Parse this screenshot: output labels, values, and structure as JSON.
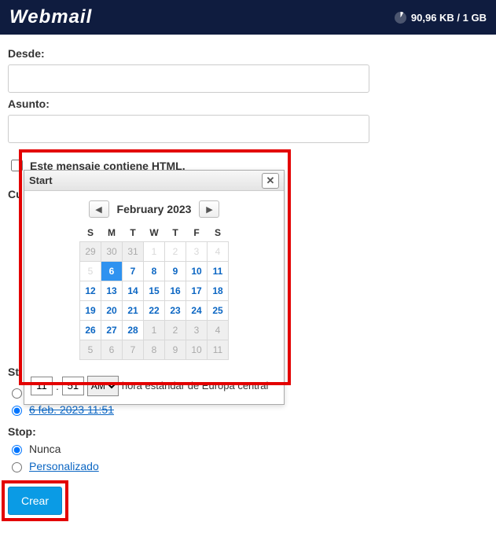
{
  "header": {
    "logo": "Webmail",
    "storage": "90,96 KB / 1 GB"
  },
  "form": {
    "desde_label": "Desde:",
    "asunto_label": "Asunto:",
    "html_checkbox_label": "Este mensaje contiene HTML.",
    "cuerpo_partial": "Cu",
    "start_partial": "St",
    "start_date_link": "6 feb. 2023 11:51",
    "stop_label": "Stop:",
    "stop_never": "Nunca",
    "stop_custom": "Personalizado",
    "create_btn": "Crear"
  },
  "datepicker": {
    "title": "Start",
    "month": "February 2023",
    "dow": [
      "S",
      "M",
      "T",
      "W",
      "T",
      "F",
      "S"
    ],
    "weeks": [
      [
        {
          "d": "29",
          "cls": "other"
        },
        {
          "d": "30",
          "cls": "other"
        },
        {
          "d": "31",
          "cls": "other"
        },
        {
          "d": "1",
          "cls": "past-sat"
        },
        {
          "d": "2",
          "cls": "past-sat"
        },
        {
          "d": "3",
          "cls": "past-sat"
        },
        {
          "d": "4",
          "cls": "past-sat"
        }
      ],
      [
        {
          "d": "5",
          "cls": "past-sat"
        },
        {
          "d": "6",
          "cls": "sel"
        },
        {
          "d": "7",
          "cls": ""
        },
        {
          "d": "8",
          "cls": ""
        },
        {
          "d": "9",
          "cls": ""
        },
        {
          "d": "10",
          "cls": ""
        },
        {
          "d": "11",
          "cls": ""
        }
      ],
      [
        {
          "d": "12",
          "cls": ""
        },
        {
          "d": "13",
          "cls": ""
        },
        {
          "d": "14",
          "cls": ""
        },
        {
          "d": "15",
          "cls": ""
        },
        {
          "d": "16",
          "cls": ""
        },
        {
          "d": "17",
          "cls": ""
        },
        {
          "d": "18",
          "cls": ""
        }
      ],
      [
        {
          "d": "19",
          "cls": ""
        },
        {
          "d": "20",
          "cls": ""
        },
        {
          "d": "21",
          "cls": ""
        },
        {
          "d": "22",
          "cls": ""
        },
        {
          "d": "23",
          "cls": ""
        },
        {
          "d": "24",
          "cls": ""
        },
        {
          "d": "25",
          "cls": ""
        }
      ],
      [
        {
          "d": "26",
          "cls": ""
        },
        {
          "d": "27",
          "cls": ""
        },
        {
          "d": "28",
          "cls": ""
        },
        {
          "d": "1",
          "cls": "other"
        },
        {
          "d": "2",
          "cls": "other"
        },
        {
          "d": "3",
          "cls": "other"
        },
        {
          "d": "4",
          "cls": "other"
        }
      ],
      [
        {
          "d": "5",
          "cls": "other"
        },
        {
          "d": "6",
          "cls": "other"
        },
        {
          "d": "7",
          "cls": "other"
        },
        {
          "d": "8",
          "cls": "other"
        },
        {
          "d": "9",
          "cls": "other"
        },
        {
          "d": "10",
          "cls": "other"
        },
        {
          "d": "11",
          "cls": "other"
        }
      ]
    ],
    "hour": "11",
    "minute": "51",
    "ampm": "AM",
    "timezone": "hora estándar de Europa central"
  }
}
